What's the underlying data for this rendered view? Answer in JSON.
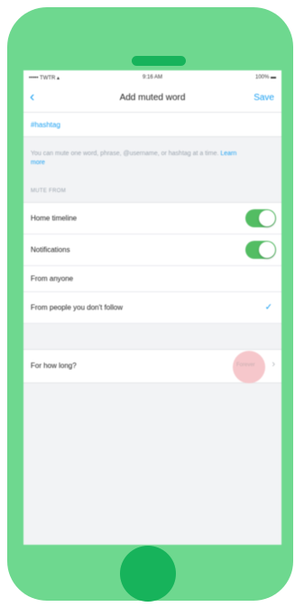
{
  "status_bar": {
    "carrier": "••••• TWTR ▴",
    "time": "9:16 AM",
    "battery": "100% ▬"
  },
  "nav": {
    "back_icon": "chevron-left-icon",
    "title": "Add muted word",
    "save_label": "Save"
  },
  "muted_word": {
    "value": "#hashtag"
  },
  "help": {
    "text": "You can mute one word, phrase, @username, or hashtag at a time.",
    "learn_more": "Learn more"
  },
  "mute_from": {
    "header": "MUTE FROM",
    "items": [
      {
        "label": "Home timeline",
        "enabled": true
      },
      {
        "label": "Notifications",
        "enabled": true
      }
    ]
  },
  "audience": {
    "items": [
      {
        "label": "From anyone",
        "selected": false
      },
      {
        "label": "From people you don't follow",
        "selected": true
      }
    ],
    "check_icon": "checkmark-icon"
  },
  "duration": {
    "label": "For how long?",
    "value": "Forever",
    "chevron_icon": "chevron-right-icon"
  },
  "colors": {
    "phone_body": "#6ed88f",
    "phone_accent": "#17b35b",
    "accent_blue": "#1da1f2",
    "toggle_on": "#53bd63",
    "touch_highlight": "#f6c7cb"
  }
}
